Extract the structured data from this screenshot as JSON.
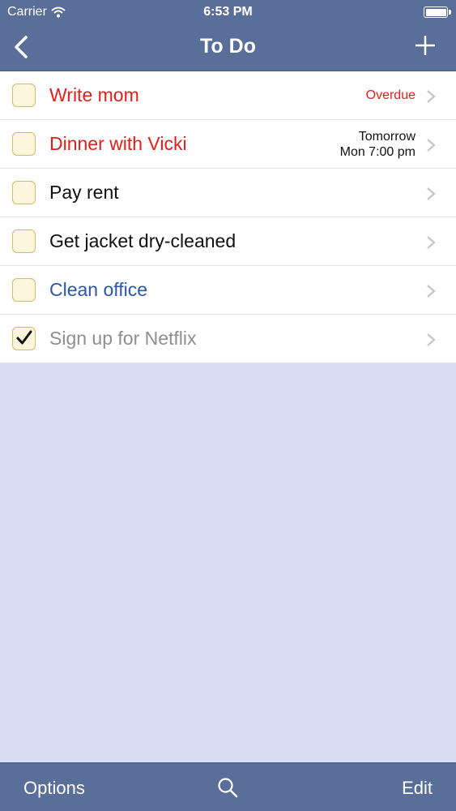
{
  "status_bar": {
    "carrier": "Carrier",
    "time": "6:53 PM",
    "icons": [
      "wifi-icon",
      "battery-icon"
    ]
  },
  "nav": {
    "title": "To Do",
    "back_icon": "chevron-left-icon",
    "add_icon": "plus-icon"
  },
  "colors": {
    "bar_blue": "#5a6e9a",
    "overdue_red": "#e0201b",
    "project_blue": "#2b57a8",
    "done_gray": "#8e8e93",
    "empty_bg": "#d9def6",
    "checkbox_fill": "#fdf6dc",
    "checkbox_border": "#d4b96a"
  },
  "tasks": [
    {
      "title": "Write mom",
      "due_line1": "Overdue",
      "due_line2": "",
      "completed": false,
      "title_color": "#e0201b",
      "due_color": "#e0201b"
    },
    {
      "title": "Dinner with Vicki",
      "due_line1": "Tomorrow",
      "due_line2": "Mon 7:00 pm",
      "completed": false,
      "title_color": "#e0201b",
      "due_color": "#111111"
    },
    {
      "title": "Pay rent",
      "due_line1": "",
      "due_line2": "",
      "completed": false,
      "title_color": "#111111",
      "due_color": "#111111"
    },
    {
      "title": "Get jacket dry-cleaned",
      "due_line1": "",
      "due_line2": "",
      "completed": false,
      "title_color": "#111111",
      "due_color": "#111111"
    },
    {
      "title": "Clean office",
      "due_line1": "",
      "due_line2": "",
      "completed": false,
      "title_color": "#2b57a8",
      "due_color": "#111111"
    },
    {
      "title": "Sign up for Netflix",
      "due_line1": "",
      "due_line2": "",
      "completed": true,
      "title_color": "#8e8e93",
      "due_color": "#111111"
    }
  ],
  "toolbar": {
    "options_label": "Options",
    "search_icon": "search-icon",
    "edit_label": "Edit"
  }
}
